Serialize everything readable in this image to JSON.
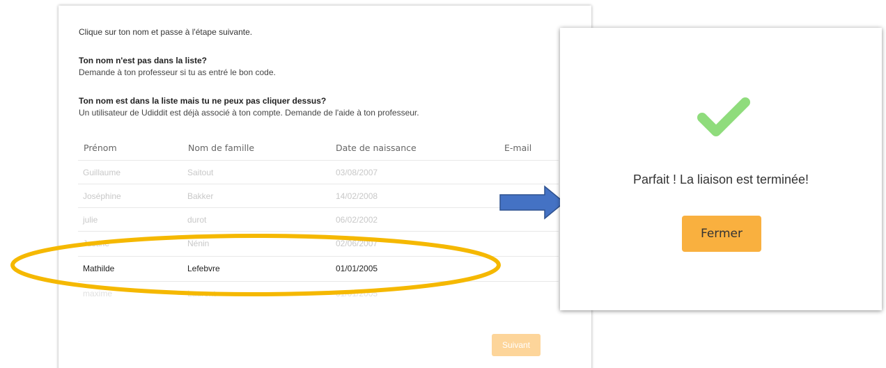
{
  "left_panel": {
    "intro": "Clique sur ton nom et passe à l'étape suivante.",
    "q1_title": "Ton nom n'est pas dans la liste?",
    "q1_body": "Demande à ton professeur si tu as entré le bon code.",
    "q2_title": "Ton nom est dans la liste mais tu ne peux pas cliquer dessus?",
    "q2_body": "Un utilisateur de Udiddit est déjà associé à ton compte. Demande de l'aide à ton professeur.",
    "columns": [
      "Prénom",
      "Nom de famille",
      "Date de naissance",
      "E-mail"
    ],
    "rows": [
      {
        "first": "Guillaume",
        "last": "Saitout",
        "dob": "03/08/2007"
      },
      {
        "first": "Joséphine",
        "last": "Bakker",
        "dob": "14/02/2008"
      },
      {
        "first": "julie",
        "last": "durot",
        "dob": "06/02/2002"
      },
      {
        "first": "Justine",
        "last": "Nénin",
        "dob": "02/06/2007"
      },
      {
        "first": "Mathilde",
        "last": "Lefebvre",
        "dob": "01/01/2005"
      },
      {
        "first": "maxime",
        "last": "Laurent",
        "dob": "01/01/2005"
      }
    ],
    "next_button": "Suivant"
  },
  "modal": {
    "message": "Parfait ! La liaison est terminée!",
    "close_button": "Fermer"
  },
  "colors": {
    "accent_orange": "#f9b03f",
    "disabled_orange": "#fdd59a",
    "highlight_ellipse": "#f5b800",
    "arrow_blue": "#4472c4",
    "check_green": "#8fdc7c"
  }
}
